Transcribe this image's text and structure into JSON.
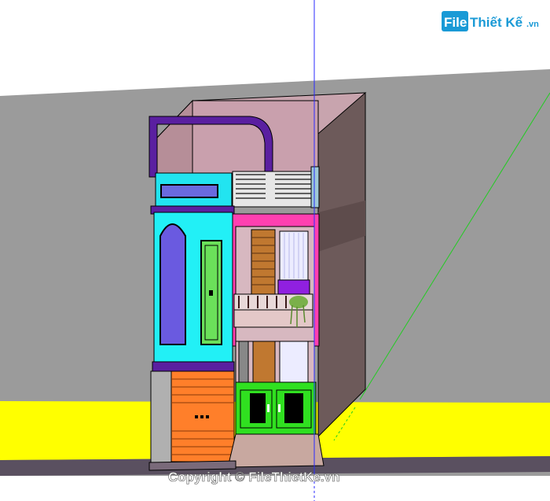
{
  "watermark": {
    "logo_prefix": "File",
    "logo_main": "Thiết Kế",
    "logo_suffix": ".vn",
    "copyright": "Copyright © FileThietKe.vn"
  },
  "scene": {
    "sky_color": "#ffffff",
    "ground_color": "#999999",
    "road_color": "#ffff00",
    "blue_axis_color": "#2a2aff",
    "green_axis_color": "#22cc22"
  }
}
